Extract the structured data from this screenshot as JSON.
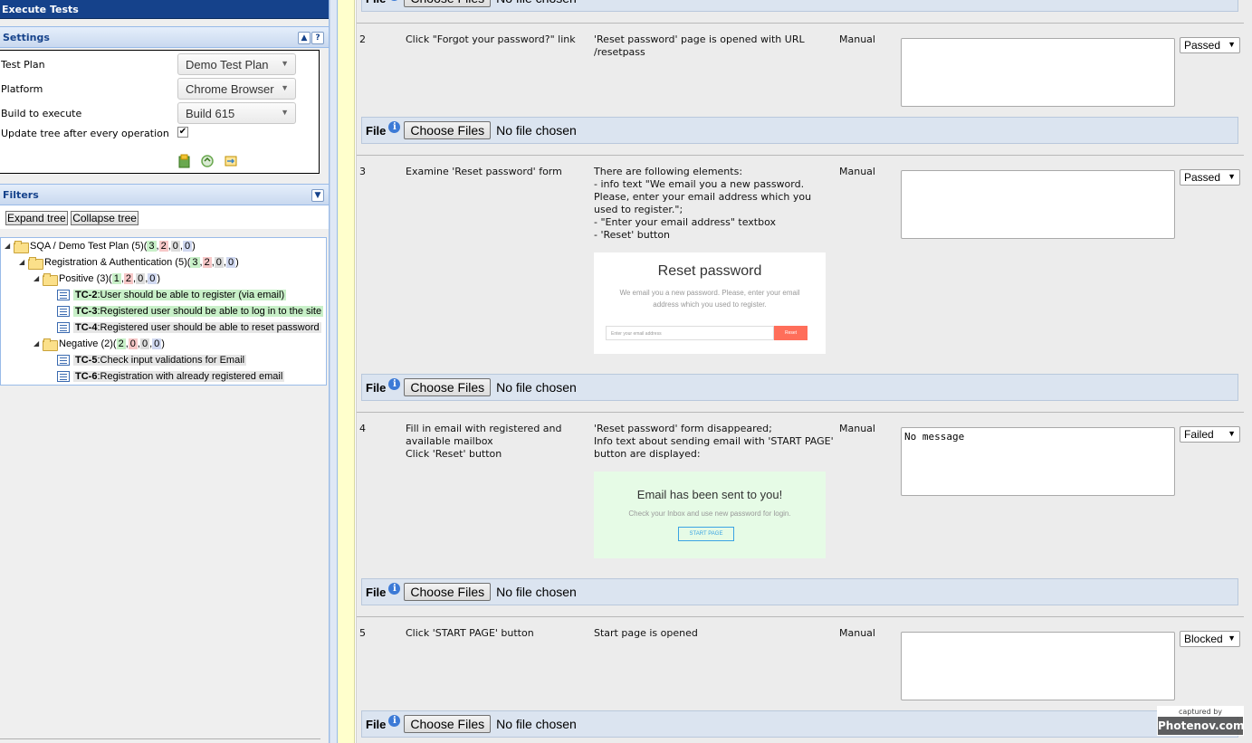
{
  "app": {
    "title": "Execute Tests"
  },
  "settings": {
    "title": "Settings",
    "collapse_glyph": "▲",
    "help_glyph": "?",
    "test_plan_label": "Test Plan",
    "test_plan_value": "Demo Test Plan",
    "platform_label": "Platform",
    "platform_value": "Chrome Browser",
    "build_label": "Build to execute",
    "build_value": "Build 615",
    "update_tree_label": "Update tree after every operation",
    "update_tree_checked": "✔"
  },
  "filters": {
    "title": "Filters",
    "expand_glyph": "▼"
  },
  "tree_buttons": {
    "expand": "Expand tree",
    "collapse": "Collapse tree"
  },
  "tree": {
    "root": {
      "label": "SQA / Demo Test Plan (5)(",
      "counts": [
        "3",
        "2",
        "0",
        "0"
      ],
      "close": ")"
    },
    "suite": {
      "label": "Registration & Authentication (5)(",
      "counts": [
        "3",
        "2",
        "0",
        "0"
      ],
      "close": ")"
    },
    "positive": {
      "label": "Positive (3)(",
      "counts": [
        "1",
        "2",
        "0",
        "0"
      ],
      "close": ")"
    },
    "negative": {
      "label": "Negative (2)(",
      "counts": [
        "2",
        "0",
        "0",
        "0"
      ],
      "close": ")"
    },
    "cases": [
      {
        "id": "TC-2",
        "title": ":User should be able to register (via email)"
      },
      {
        "id": "TC-3",
        "title": ":Registered user should be able to log in to the site"
      },
      {
        "id": "TC-4",
        "title": ":Registered user should be able to reset password"
      },
      {
        "id": "TC-5",
        "title": ":Check input validations for Email"
      },
      {
        "id": "TC-6",
        "title": ":Registration with already registered email"
      }
    ]
  },
  "file_bar": {
    "label": "File",
    "button": "Choose Files",
    "status": "No file chosen"
  },
  "steps": [
    {
      "num": "2",
      "action": "Click \"Forgot your password?\" link",
      "expected": "'Reset password' page is opened with URL /resetpass",
      "type": "Manual",
      "notes": "",
      "status": "Passed"
    },
    {
      "num": "3",
      "action": "Examine 'Reset password' form",
      "expected_lines": [
        "There are following elements:",
        "- info text \"We email you a new password. Please, enter your email address which you used to register.\";",
        "- \"Enter your email address\" textbox",
        "- 'Reset' button"
      ],
      "type": "Manual",
      "notes": "",
      "status": "Passed",
      "image": {
        "title": "Reset password",
        "sub": "We email you a new password. Please, enter your email address which you used to register.",
        "placeholder": "Enter your email address",
        "button": "Reset"
      }
    },
    {
      "num": "4",
      "action_lines": [
        "Fill in email with registered and available mailbox",
        "Click 'Reset' button"
      ],
      "expected_lines": [
        "'Reset password' form disappeared;",
        "Info text about sending email with 'START PAGE' button are displayed:"
      ],
      "type": "Manual",
      "notes": "No message",
      "status": "Failed",
      "image": {
        "title": "Email has been sent to you!",
        "sub": "Check your Inbox and use new password for login.",
        "button": "START PAGE"
      }
    },
    {
      "num": "5",
      "action": "Click 'START PAGE' button",
      "expected": "Start page is opened",
      "type": "Manual",
      "notes": "",
      "status": "Blocked"
    }
  ],
  "watermark": {
    "top": "captured by",
    "bottom": "Photenov.com"
  },
  "colors": {
    "header": "#15428b",
    "panel": "#dfe8f6",
    "file_bar": "#dbe4f0",
    "passed": "#c8f0c8",
    "failed": "#f7c8c8"
  },
  "icons": [
    "collapse-up-icon",
    "help-icon",
    "collapse-down-icon",
    "folder-icon",
    "testcase-icon",
    "info-icon",
    "save-icon",
    "refresh-icon",
    "export-icon"
  ]
}
